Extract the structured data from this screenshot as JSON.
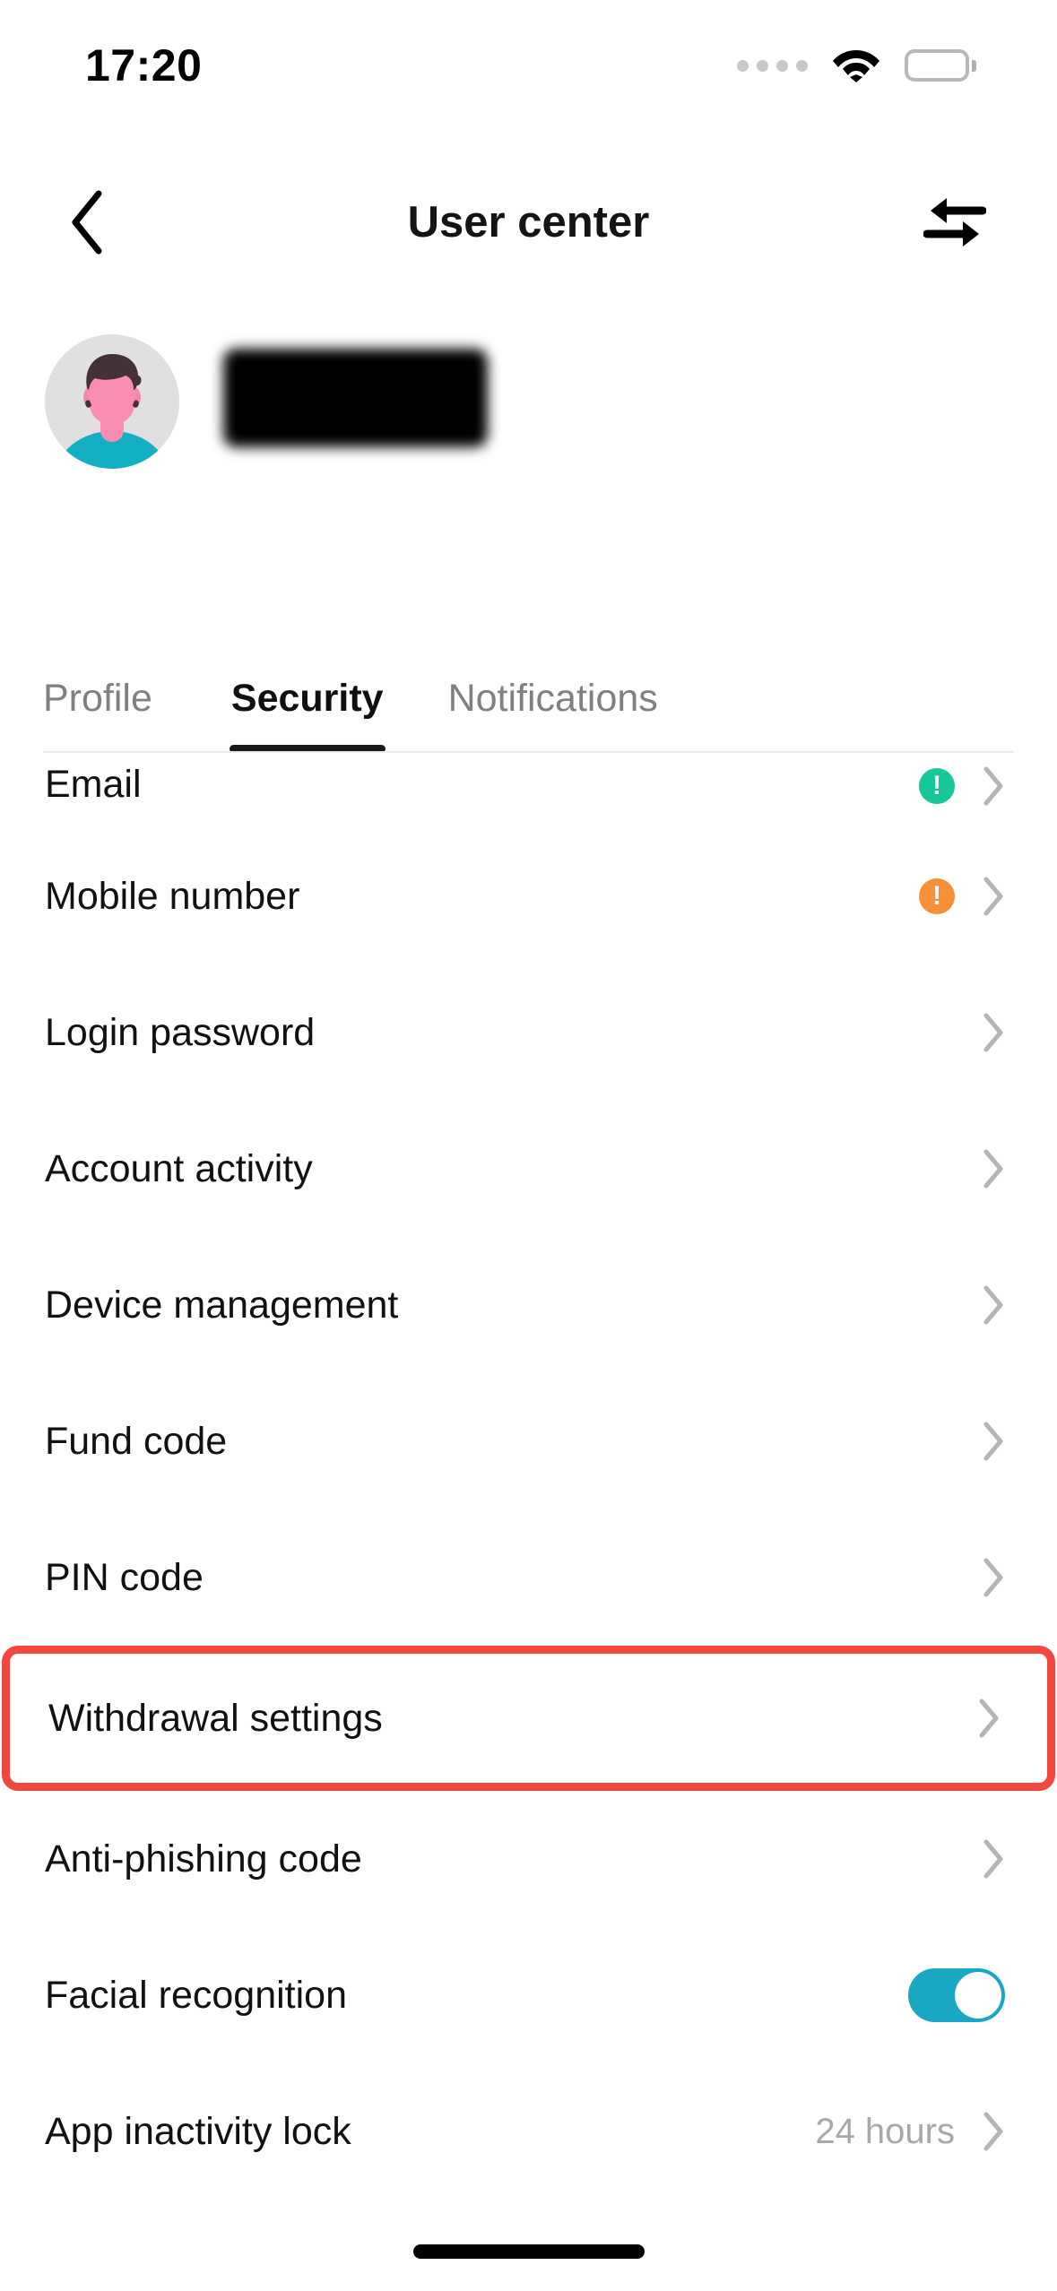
{
  "status_bar": {
    "time": "17:20",
    "signal_icon": "signal-dots-icon",
    "wifi_icon": "wifi-icon",
    "battery_icon": "battery-full-icon"
  },
  "nav": {
    "back_icon": "chevron-left-icon",
    "title": "User center",
    "switch_icon": "switch-arrows-icon"
  },
  "profile": {
    "avatar_icon": "user-avatar-icon",
    "username": "",
    "username_redacted": true
  },
  "tabs": [
    {
      "label": "Profile",
      "active": false
    },
    {
      "label": "Security",
      "active": true
    },
    {
      "label": "Notifications",
      "active": false
    }
  ],
  "security_list": [
    {
      "label": "Email",
      "value": "",
      "status": "ok",
      "control": "chevron",
      "clipped": true,
      "highlighted": false
    },
    {
      "label": "Mobile number",
      "value": "",
      "status": "warn",
      "control": "chevron",
      "clipped": false,
      "highlighted": false
    },
    {
      "label": "Login password",
      "value": "",
      "status": "",
      "control": "chevron",
      "clipped": false,
      "highlighted": false
    },
    {
      "label": "Account activity",
      "value": "",
      "status": "",
      "control": "chevron",
      "clipped": false,
      "highlighted": false
    },
    {
      "label": "Device management",
      "value": "",
      "status": "",
      "control": "chevron",
      "clipped": false,
      "highlighted": false
    },
    {
      "label": "Fund code",
      "value": "",
      "status": "",
      "control": "chevron",
      "clipped": false,
      "highlighted": false
    },
    {
      "label": "PIN code",
      "value": "",
      "status": "",
      "control": "chevron",
      "clipped": false,
      "highlighted": false
    },
    {
      "label": "Withdrawal settings",
      "value": "",
      "status": "",
      "control": "chevron",
      "clipped": false,
      "highlighted": true
    },
    {
      "label": "Anti-phishing code",
      "value": "",
      "status": "",
      "control": "chevron",
      "clipped": false,
      "highlighted": false
    },
    {
      "label": "Facial recognition",
      "value": "",
      "status": "",
      "control": "toggle-on",
      "clipped": false,
      "highlighted": false
    },
    {
      "label": "App inactivity lock",
      "value": "24 hours",
      "status": "",
      "control": "chevron",
      "clipped": false,
      "highlighted": false
    }
  ],
  "colors": {
    "accent_teal": "#18A8C4",
    "highlight_red": "#F0483E",
    "warning_orange": "#F79039",
    "success_green": "#16C79A",
    "text_primary": "#111111",
    "text_muted": "#a8a8a8"
  },
  "home_indicator": "home-indicator"
}
